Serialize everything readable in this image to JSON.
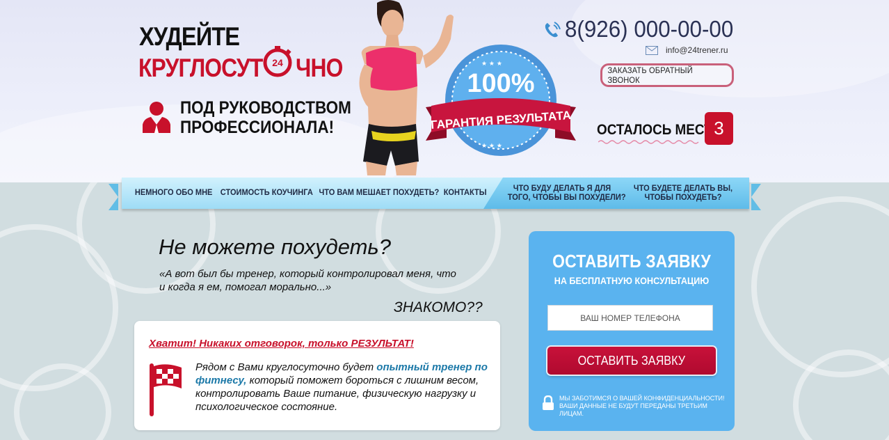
{
  "header": {
    "logo_line1": "ХУДЕЙТЕ",
    "logo_line2_part1": "КРУГЛОСУТ",
    "logo_clock_number": "24",
    "logo_line2_part2": "ЧНО",
    "pro_line1": "ПОД РУКОВОДСТВОМ",
    "pro_line2": "ПРОФЕССИОНАЛА!",
    "phone": "8(926) 000-00-00",
    "email": "info@24trener.ru",
    "callback_label": "ЗАКАЗАТЬ ОБРАТНЫЙ ЗВОНОК",
    "places_label": "ОСТАЛОСЬ МЕСТ:",
    "places_value": "3",
    "badge_percent": "100%",
    "badge_text": "ГАРАНТИЯ РЕЗУЛЬТАТА"
  },
  "nav": {
    "items": [
      {
        "label": "НЕМНОГО ОБО МНЕ"
      },
      {
        "label": "СТОИМОСТЬ КОУЧИНГА"
      },
      {
        "label": "ЧТО ВАМ МЕШАЕТ ПОХУДЕТЬ?"
      },
      {
        "label": "КОНТАКТЫ"
      },
      {
        "label_line1": "ЧТО БУДУ ДЕЛАТЬ Я ДЛЯ",
        "label_line2": "ТОГО, ЧТОБЫ ВЫ ПОХУДЕЛИ?"
      },
      {
        "label_line1": "ЧТО БУДЕТЕ ДЕЛАТЬ ВЫ,",
        "label_line2": "ЧТОБЫ ПОХУДЕТЬ?"
      }
    ]
  },
  "main": {
    "question": "Не можете похудеть?",
    "quote_line1": "«А вот был бы тренер, который контролировал меня, что",
    "quote_line2": "и когда я ем, помогал морально...»",
    "familiar": "ЗНАКОМО??",
    "card_title": "Хватит! Никаких отговорок, только РЕЗУЛЬТАТ!",
    "card_text_before": "Рядом с Вами круглосуточно будет ",
    "card_text_highlight": "опытный тренер по фитнесу,",
    "card_text_after": " который поможет бороться с лишним весом, контролировать Ваше питание, физическую нагрузку и психологическое состояние."
  },
  "form": {
    "title": "ОСТАВИТЬ ЗАЯВКУ",
    "subtitle": "НА БЕСПЛАТНУЮ КОНСУЛЬТАЦИЮ",
    "phone_placeholder": "ВАШ НОМЕР ТЕЛЕФОНА",
    "submit_label": "ОСТАВИТЬ ЗАЯВКУ",
    "privacy_line1": "МЫ ЗАБОТИМСЯ О ВАШЕЙ КОНФИДЕНЦИАЛЬНОСТИ!",
    "privacy_line2": "ВАШИ ДАННЫЕ НЕ БУДУТ ПЕРЕДАНЫ ТРЕТЬИМ ЛИЦАМ."
  },
  "colors": {
    "brand_red": "#c8112b",
    "form_blue": "#5ab3ef",
    "nav_blue": "#5ebbe9",
    "highlight_blue": "#1c79a8"
  },
  "icons": [
    "clock-24-icon",
    "person-icon",
    "phone-icon",
    "mail-icon",
    "flag-icon",
    "lock-icon"
  ]
}
